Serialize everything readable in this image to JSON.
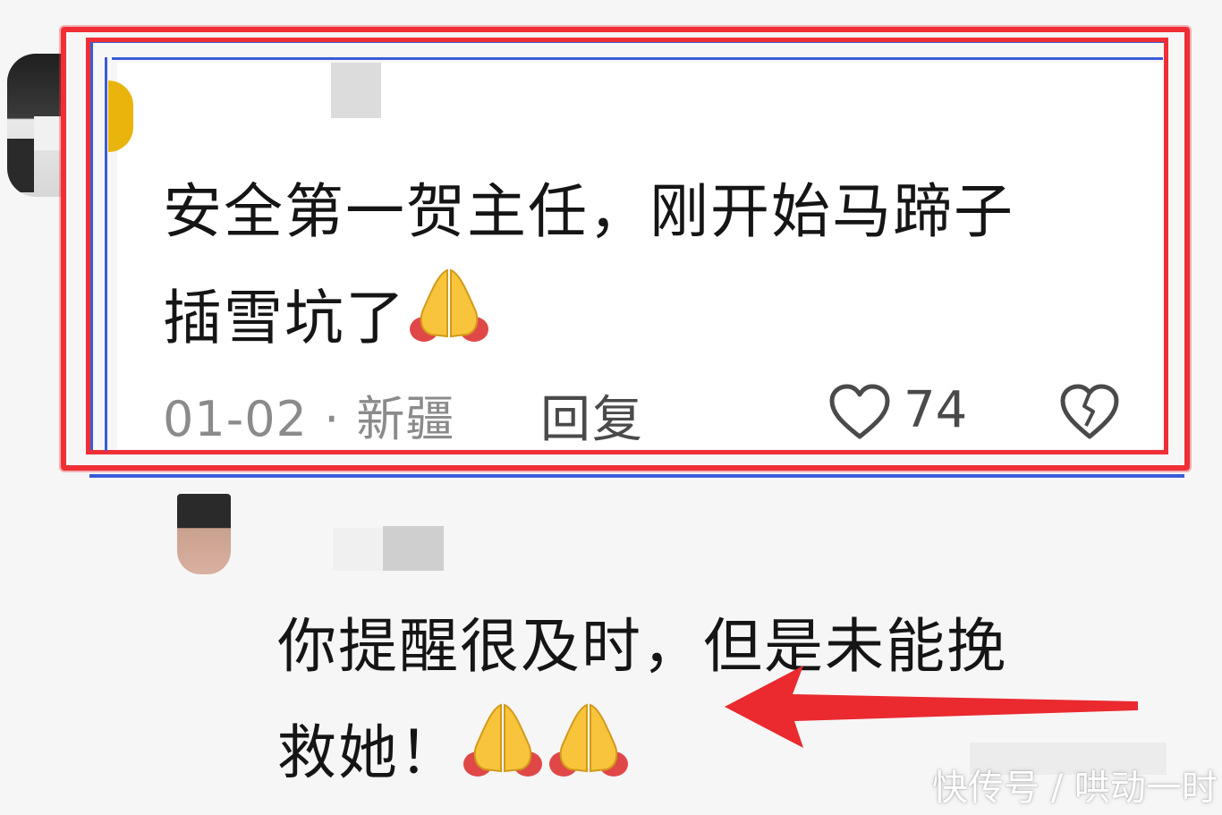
{
  "colors": {
    "highlight_red": "#ef2f35",
    "highlight_blue": "#3b5bd6",
    "arrow_red": "#ea2a2f",
    "meta_gray": "#8b8b8b"
  },
  "comment": {
    "text_line1": "安全第一贺主任，刚开始马蹄子",
    "text_line2": "插雪坑了",
    "emoji": "folded-hands-icon",
    "meta": "01-02 · 新疆",
    "reply_label": "回复",
    "like_count": "74"
  },
  "reply": {
    "text_line1": "你提醒很及时，但是未能挽",
    "text_line2": "救她！",
    "emoji_count": 2
  },
  "watermark": "快传号 / 哄动一时"
}
